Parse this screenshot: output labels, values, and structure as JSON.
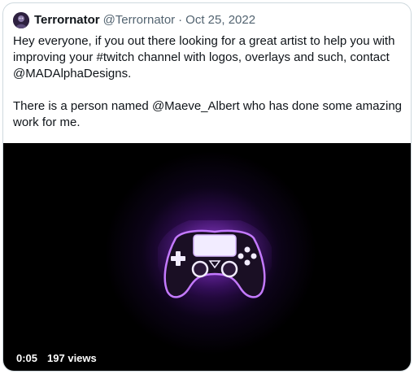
{
  "tweet": {
    "author": {
      "display_name": "Terrornator",
      "handle": "@Terrornator",
      "separator": "·",
      "date": "Oct 25, 2022"
    },
    "body": {
      "p1_before": "Hey everyone, if you out there looking for a great artist to help you with improving your ",
      "hashtag": "#twitch",
      "p1_middle": " channel with logos, overlays and such, contact ",
      "mention_1": "@MADAlphaDesigns",
      "p1_end": ".",
      "p2_before": "There is a person named ",
      "mention_2": "@Maeve_Albert",
      "p2_end": " who has done some amazing work for me."
    },
    "media": {
      "type": "video",
      "duration": "0:05",
      "views": "197 views",
      "glow_color": "#8228c8"
    }
  },
  "colors": {
    "text": "#0f1419",
    "secondary": "#536471",
    "border": "#cfd9de"
  },
  "icons": {
    "avatar": "avatar-image",
    "controller": "gamepad-icon"
  }
}
